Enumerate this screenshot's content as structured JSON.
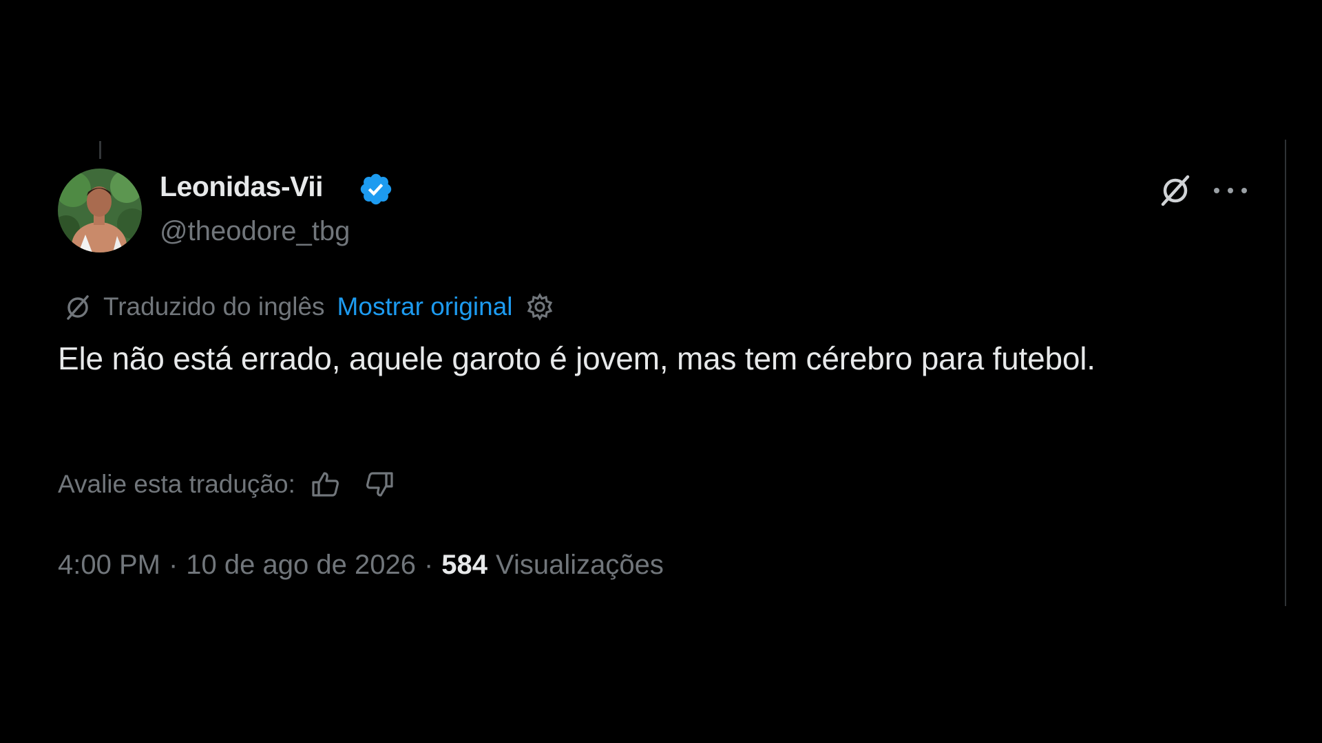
{
  "tweet": {
    "author_name": "Leonidas-Vii",
    "handle": "@theodore_tbg",
    "verified": true,
    "translated_label": "Traduzido do inglês",
    "show_original_label": "Mostrar original",
    "text": "Ele não está errado, aquele garoto é jovem, mas tem cérebro para futebol.",
    "rate_label": "Avalie esta tradução:",
    "time": "4:00 PM",
    "date": "10 de ago de 2026",
    "separator": "·",
    "views_count": "584",
    "views_label": "Visualizações"
  },
  "icons": {
    "verified": "verified-badge-icon",
    "grok": "grok-icon",
    "more": "more-options-icon",
    "translate": "translate-icon",
    "settings": "settings-icon",
    "thumb_up": "thumb-up-icon",
    "thumb_down": "thumb-down-icon"
  },
  "colors": {
    "background": "#000000",
    "primary_text": "#e7e9ea",
    "secondary_text": "#71767b",
    "accent": "#1d9bf0"
  }
}
